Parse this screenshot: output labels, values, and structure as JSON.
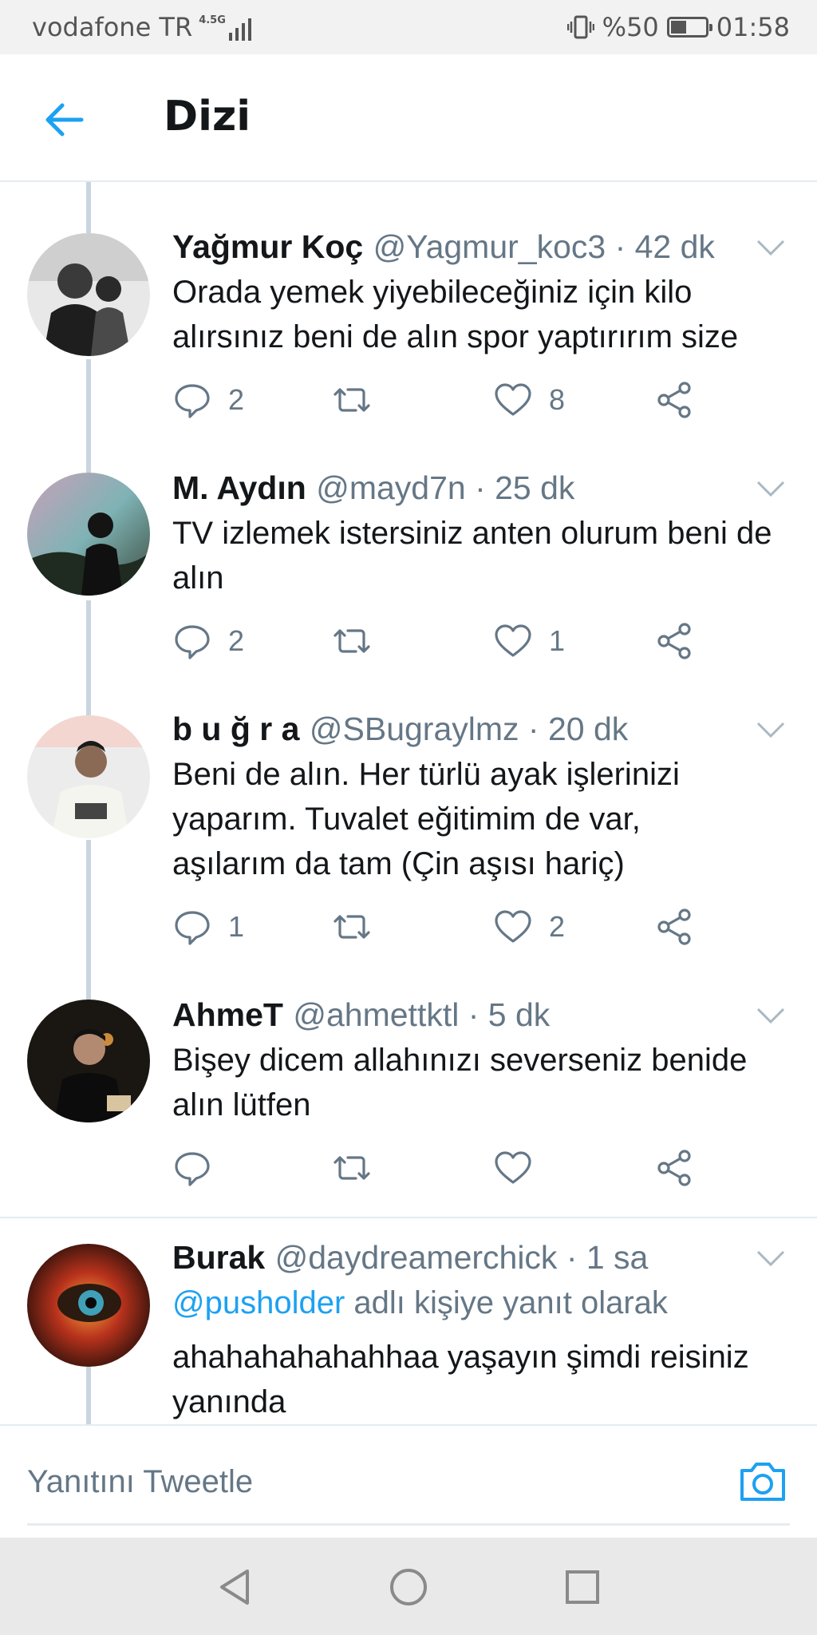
{
  "status_bar": {
    "carrier": "vodafone TR",
    "network": "4.5G",
    "battery_percent": "%50",
    "battery_level": 0.5,
    "time": "01:58"
  },
  "header": {
    "title": "Dizi"
  },
  "tweets": [
    {
      "name": "Yağmur Koç",
      "handle": "@Yagmur_koc3 · 42 dk",
      "text": "Orada yemek yiyebileceğiniz için kilo alırsınız beni de alın spor yaptırırım size",
      "replies": "2",
      "retweets": "",
      "likes": "8"
    },
    {
      "name": "M. Aydın",
      "handle": "@mayd7n · 25 dk",
      "text": "TV izlemek istersiniz anten olurum beni de alın",
      "replies": "2",
      "retweets": "",
      "likes": "1"
    },
    {
      "name": "b u ğ r a",
      "handle": "@SBugraylmz · 20 dk",
      "text": "Beni de alın. Her türlü ayak işlerinizi yaparım. Tuvalet eğitimim de var, aşılarım da tam (Çin aşısı hariç)",
      "replies": "1",
      "retweets": "",
      "likes": "2"
    },
    {
      "name": "AhmeT",
      "handle": "@ahmettktl · 5 dk",
      "text": "Bişey dicem allahınızı severseniz benide alın lütfen",
      "replies": "",
      "retweets": "",
      "likes": ""
    },
    {
      "name": "Burak",
      "handle": "@daydreamerchick · 1 sa",
      "reply_mention": "@pusholder",
      "reply_suffix": " adlı kişiye yanıt olarak",
      "text": "ahahahahahahhaa yaşayın şimdi reisiniz yanında"
    }
  ],
  "reply_bar": {
    "placeholder": "Yanıtını Tweetle"
  },
  "colors": {
    "accent": "#1da1f2",
    "secondary_text": "#657786",
    "thread_line": "#c9d6df"
  },
  "icons": [
    "back-arrow-icon",
    "chevron-down-icon",
    "reply-icon",
    "retweet-icon",
    "like-icon",
    "share-icon",
    "camera-icon",
    "nav-back-icon",
    "nav-home-icon",
    "nav-recents-icon"
  ]
}
